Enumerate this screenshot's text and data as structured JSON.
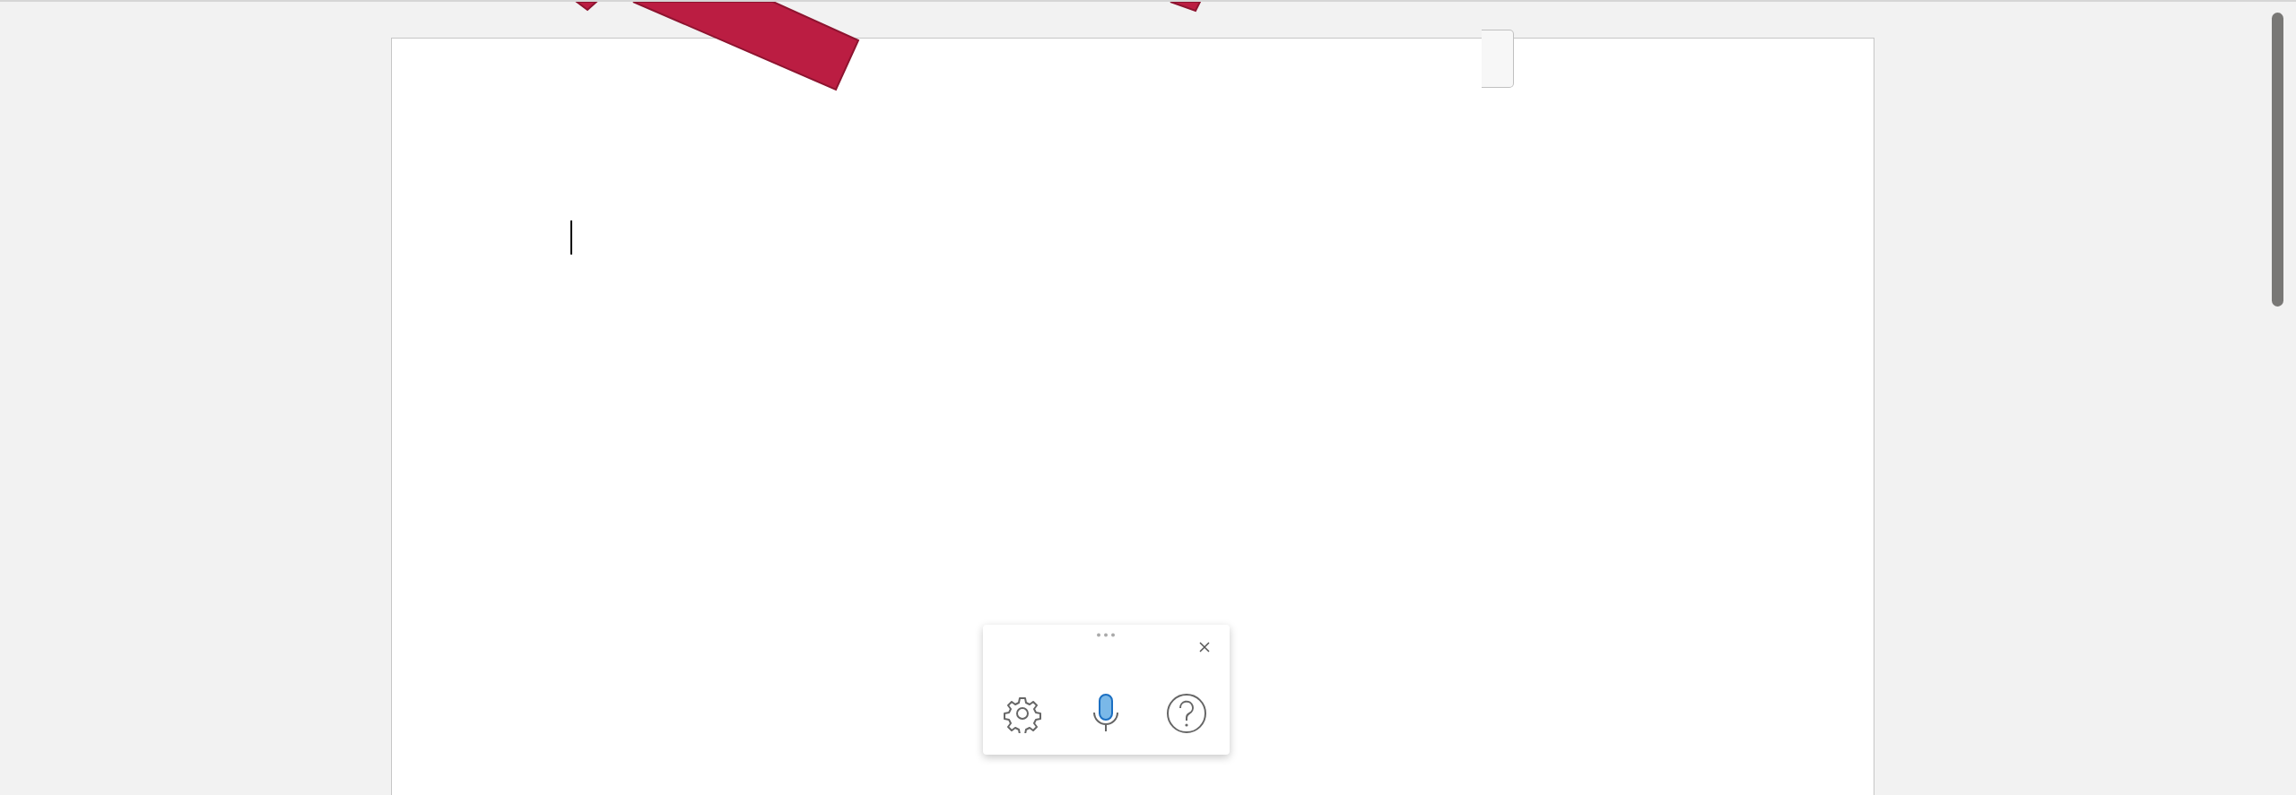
{
  "dictation_toolbar": {
    "microphone": {
      "on": true
    }
  }
}
